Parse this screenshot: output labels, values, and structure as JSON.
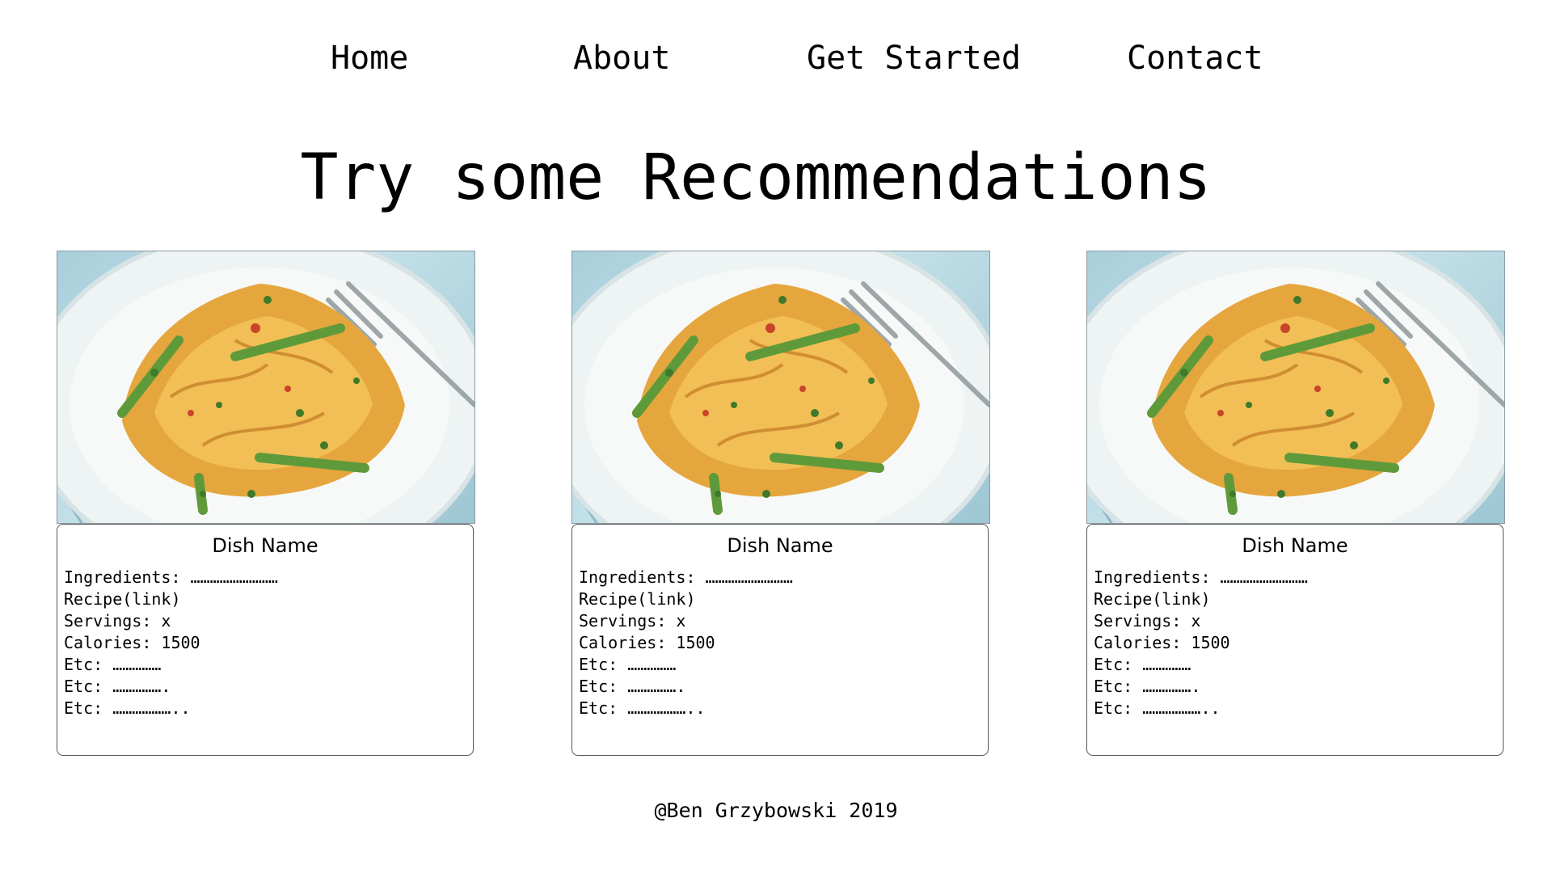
{
  "nav": {
    "items": [
      {
        "label": "Home"
      },
      {
        "label": "About"
      },
      {
        "label": "Get Started"
      },
      {
        "label": "Contact"
      }
    ]
  },
  "heading": "Try some Recommendations",
  "cards": [
    {
      "dish_name": "Dish Name",
      "lines": [
        "Ingredients: ………………………",
        "Recipe(link)",
        "Servings: x",
        "Calories: 1500",
        "Etc: ……………",
        "Etc: …………….",
        "Etc: ……………….."
      ]
    },
    {
      "dish_name": "Dish Name",
      "lines": [
        "Ingredients: ………………………",
        "Recipe(link)",
        "Servings: x",
        "Calories: 1500",
        "Etc: ……………",
        "Etc: …………….",
        "Etc: ……………….."
      ]
    },
    {
      "dish_name": "Dish Name",
      "lines": [
        "Ingredients: ………………………",
        "Recipe(link)",
        "Servings: x",
        "Calories: 1500",
        "Etc: ……………",
        "Etc: …………….",
        "Etc: ……………….."
      ]
    }
  ],
  "footer": "@Ben Grzybowski 2019",
  "colors": {
    "text": "#000000",
    "background": "#ffffff",
    "table_blue": "#a9cfdb",
    "pasta": "#e2a23c",
    "asparagus": "#5f9a3a"
  }
}
